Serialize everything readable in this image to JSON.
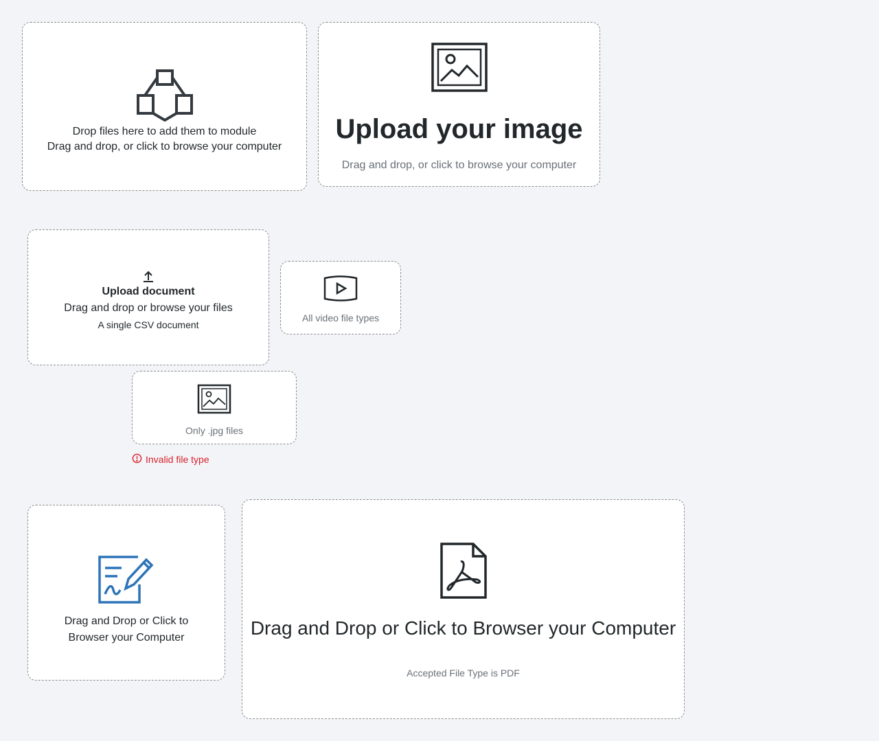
{
  "dropzone_module": {
    "line1": "Drop files here to add them to module",
    "line2": "Drag and drop, or click to browse your computer",
    "icon": "module-network-icon"
  },
  "dropzone_image_large": {
    "title": "Upload your image",
    "subtitle": "Drag and drop, or click to browse your computer",
    "icon": "image-icon"
  },
  "dropzone_document": {
    "title": "Upload document",
    "subtitle": "Drag and drop or browse your files",
    "hint": "A single CSV document",
    "icon": "upload-icon"
  },
  "dropzone_video": {
    "caption": "All video file types",
    "icon": "video-play-icon"
  },
  "dropzone_jpg": {
    "caption": "Only .jpg files",
    "icon": "image-icon",
    "error": "Invalid file type",
    "error_color": "#da1e28"
  },
  "dropzone_sign": {
    "line1": "Drag and Drop or Click to",
    "line2": "Browser your Computer",
    "icon": "signature-edit-icon",
    "icon_color": "#2d74b8"
  },
  "dropzone_pdf": {
    "title": "Drag and Drop or Click to Browser your Computer",
    "caption": "Accepted File Type is PDF",
    "icon": "pdf-file-icon"
  }
}
